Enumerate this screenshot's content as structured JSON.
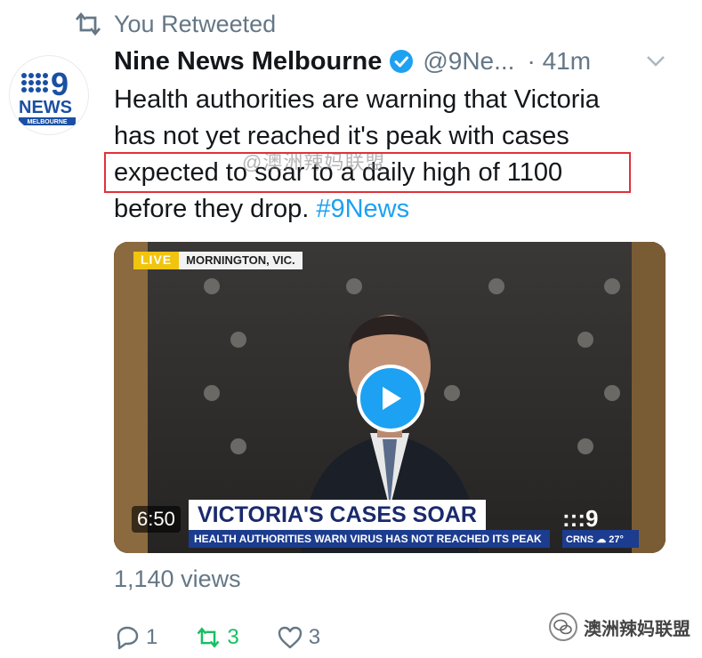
{
  "retweet": {
    "icon": "retweet-icon",
    "label": "You Retweeted"
  },
  "tweet": {
    "avatar_logo": {
      "top": "9",
      "mid": "NEWS",
      "bottom": "MELBOURNE"
    },
    "author_name": "Nine News Melbourne",
    "handle": "@9Ne...",
    "time": "· 41m",
    "text_lines": [
      "Health authorities are warning that Victoria",
      "has not yet reached it's peak with cases",
      "expected to soar to a daily high of 1100",
      "before they drop. "
    ],
    "hashtag": "#9News",
    "watermark": "@澳洲辣妈联盟"
  },
  "video": {
    "live_label": "LIVE",
    "location": "MORNINGTON, VIC.",
    "duration": "6:50",
    "headline": "VICTORIA'S CASES SOAR",
    "ticker": "HEALTH AUTHORITIES WARN VIRUS HAS NOT REACHED ITS PEAK",
    "channel_logo": ":::9",
    "weather": "CRNS ☁ 27°"
  },
  "stats": {
    "views": "1,140 views"
  },
  "actions": {
    "reply_count": "1",
    "retweet_count": "3",
    "like_count": "3"
  },
  "footer_watermark": "澳洲辣妈联盟",
  "colors": {
    "link": "#1da1f2",
    "retweet": "#17bf63",
    "highlight": "#e0323a",
    "muted": "#657786"
  }
}
